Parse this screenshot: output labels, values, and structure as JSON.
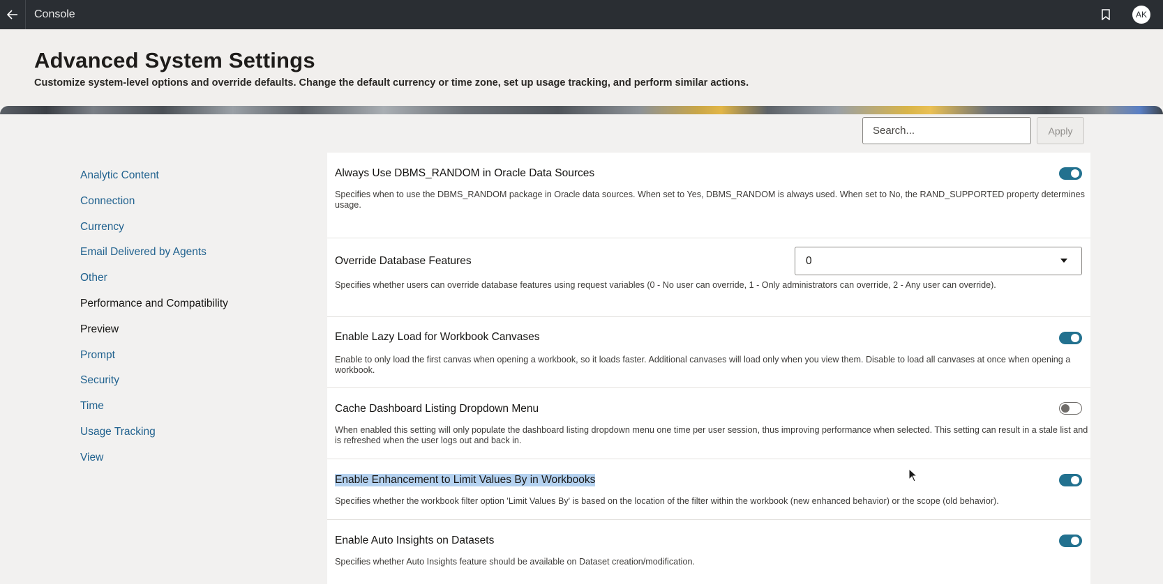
{
  "topbar": {
    "title": "Console",
    "avatar_initials": "AK",
    "icons": [
      "back-arrow-icon",
      "bookmark-icon"
    ]
  },
  "header": {
    "title": "Advanced System Settings",
    "subtitle": "Customize system-level options and override defaults. Change the default currency or time zone, set up usage tracking, and perform similar actions."
  },
  "search": {
    "placeholder": "Search...",
    "apply_label": "Apply"
  },
  "sidebar": {
    "items": [
      {
        "label": "Analytic Content",
        "active": false
      },
      {
        "label": "Connection",
        "active": false
      },
      {
        "label": "Currency",
        "active": false
      },
      {
        "label": "Email Delivered by Agents",
        "active": false
      },
      {
        "label": "Other",
        "active": false
      },
      {
        "label": "Performance and Compatibility",
        "active": true
      },
      {
        "label": "Preview",
        "active": true
      },
      {
        "label": "Prompt",
        "active": false
      },
      {
        "label": "Security",
        "active": false
      },
      {
        "label": "Time",
        "active": false
      },
      {
        "label": "Usage Tracking",
        "active": false
      },
      {
        "label": "View",
        "active": false
      }
    ]
  },
  "settings": [
    {
      "title": "Always Use DBMS_RANDOM in Oracle Data Sources",
      "description": "Specifies when to use the DBMS_RANDOM package in Oracle data sources. When set to Yes, DBMS_RANDOM is always used. When set to No, the RAND_SUPPORTED property determines usage.",
      "control": "toggle",
      "enabled": true
    },
    {
      "title": "Override Database Features",
      "description": "Specifies whether users can override database features using request variables (0 - No user can override, 1 - Only administrators can override, 2 - Any user can override).",
      "control": "select",
      "value": "0"
    },
    {
      "title": "Enable Lazy Load for Workbook Canvases",
      "description": "Enable to only load the first canvas when opening a workbook, so it loads faster. Additional canvases will load only when you view them. Disable to load all canvases at once when opening a workbook.",
      "control": "toggle",
      "enabled": true
    },
    {
      "title": "Cache Dashboard Listing Dropdown Menu",
      "description": "When enabled this setting will only populate the dashboard listing dropdown menu one time per user session, thus improving performance when selected. This setting can result in a stale list and is refreshed when the user logs out and back in.",
      "control": "toggle",
      "enabled": false
    },
    {
      "title": "Enable Enhancement to Limit Values By in Workbooks",
      "description": "Specifies whether the workbook filter option 'Limit Values By' is based on the location of the filter within the workbook (new enhanced behavior) or the scope (old behavior).",
      "control": "toggle",
      "enabled": true,
      "text_selected": true
    },
    {
      "title": "Enable Auto Insights on Datasets",
      "description": "Specifies whether Auto Insights feature should be available on Dataset creation/modification.",
      "control": "toggle",
      "enabled": true
    }
  ],
  "colors": {
    "topbar": "#2a2e33",
    "link": "#21628f",
    "toggle_on": "#22718f",
    "selection": "#b5d2f0"
  }
}
